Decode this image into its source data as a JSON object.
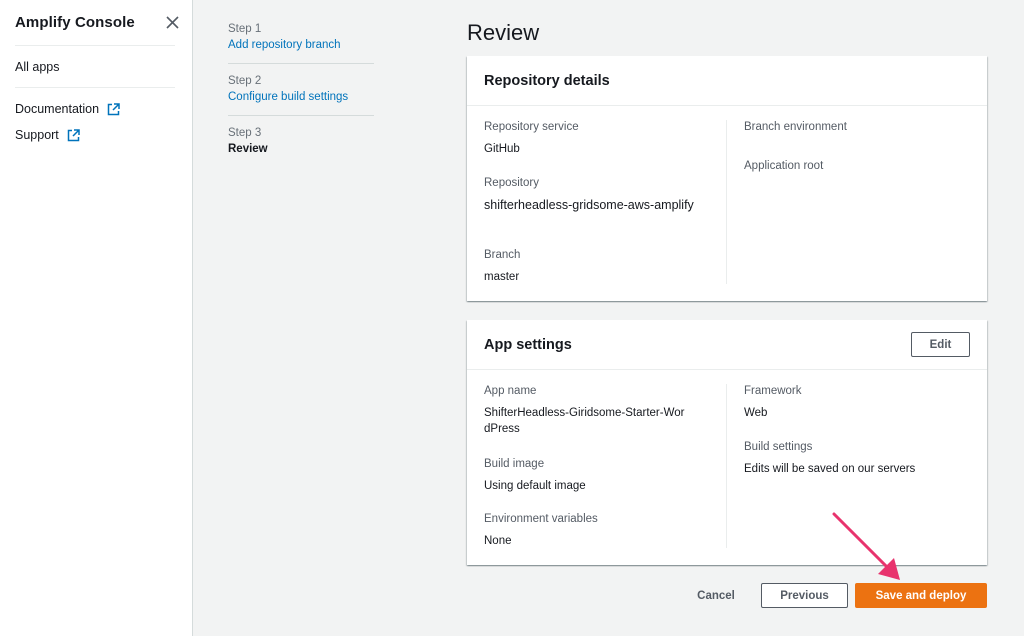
{
  "sidebar": {
    "title": "Amplify Console",
    "all_apps": "All apps",
    "documentation": "Documentation",
    "support": "Support"
  },
  "steps": [
    {
      "num": "Step 1",
      "label": "Add repository branch"
    },
    {
      "num": "Step 2",
      "label": "Configure build settings"
    },
    {
      "num": "Step 3",
      "label": "Review"
    }
  ],
  "page": {
    "title": "Review"
  },
  "repo_panel": {
    "title": "Repository details",
    "service_key": "Repository service",
    "service_val": "GitHub",
    "repo_key": "Repository",
    "repo_val": "shifterheadless-gridsome-aws-amplify",
    "branch_key": "Branch",
    "branch_val": "master",
    "env_key": "Branch environment",
    "root_key": "Application root"
  },
  "app_panel": {
    "title": "App settings",
    "edit_label": "Edit",
    "name_key": "App name",
    "name_val": "ShifterHeadless-Giridsome-Starter-WordPress",
    "image_key": "Build image",
    "image_val": "Using default image",
    "envvars_key": "Environment variables",
    "envvars_val": "None",
    "framework_key": "Framework",
    "framework_val": "Web",
    "build_key": "Build settings",
    "build_val": "Edits will be saved on our servers"
  },
  "footer": {
    "cancel": "Cancel",
    "previous": "Previous",
    "save": "Save and deploy"
  },
  "colors": {
    "primary": "#ec7211",
    "link": "#0073bb",
    "annotation_arrow": "#e8336d"
  }
}
